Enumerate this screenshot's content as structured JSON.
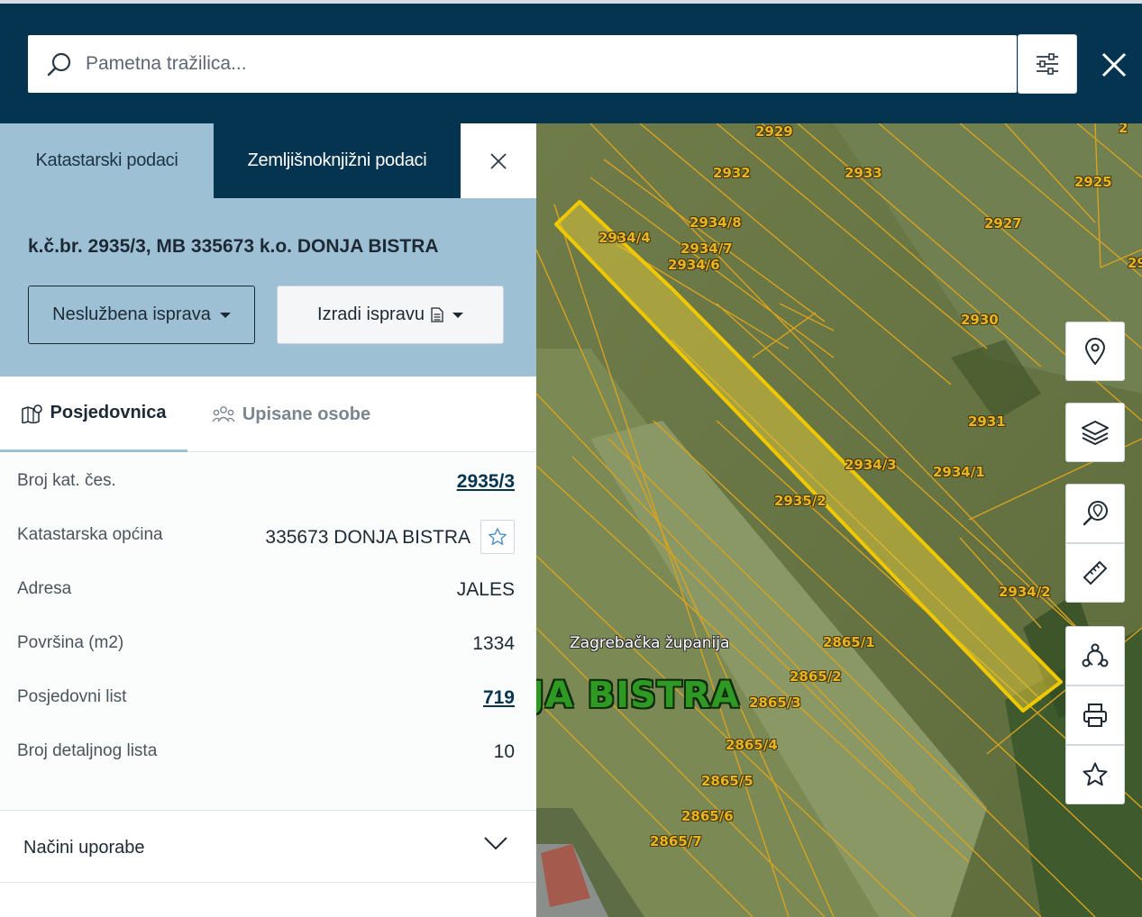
{
  "search": {
    "placeholder": "Pametna tražilica..."
  },
  "icons": {
    "search": "search-icon",
    "filter": "sliders-icon",
    "close": "close-icon",
    "document": "document-icon",
    "map_pin": "map-pin-icon",
    "layers": "layers-icon",
    "location_search": "location-search-icon",
    "ruler": "ruler-icon",
    "shapes": "shapes-icon",
    "print": "printer-icon",
    "star": "star-icon",
    "chevron": "chevron-down-icon"
  },
  "colors": {
    "header": "#04344f",
    "accent": "#9ec0d5",
    "parcel_outline": "#f0c800",
    "parcel_fill": "#d8c23a"
  },
  "tabs": [
    {
      "label": "Katastarski podaci",
      "active": true
    },
    {
      "label": "Zemljišnoknjižni podaci",
      "active": false
    }
  ],
  "parcel": {
    "title": "k.č.br. 2935/3, MB 335673 k.o. DONJA BISTRA",
    "btn_nesluzbena": "Neslužbena isprava",
    "btn_izradi": "Izradi ispravu"
  },
  "subtabs": [
    {
      "label": "Posjedovnica",
      "active": true
    },
    {
      "label": "Upisane osobe",
      "active": false
    }
  ],
  "details": [
    {
      "label": "Broj kat. čes.",
      "value": "2935/3",
      "link": true
    },
    {
      "label": "Katastarska općina",
      "value": "335673 DONJA BISTRA",
      "link": false
    },
    {
      "label": "Adresa",
      "value": "JALES",
      "link": false
    },
    {
      "label": "Površina (m2)",
      "value": "1334",
      "link": false
    },
    {
      "label": "Posjedovni list",
      "value": "719",
      "link": true
    },
    {
      "label": "Broj detaljnog lista",
      "value": "10",
      "link": false
    }
  ],
  "nacini": {
    "label": "Načini uporabe"
  },
  "map": {
    "county": "Zagrebačka županija",
    "town": "JA BISTRA",
    "parcel_labels": [
      "2929",
      "2932",
      "2933",
      "2925",
      "2934/8",
      "2934/4",
      "2934/7",
      "2934/6",
      "2927",
      "2930",
      "2931",
      "2934/3",
      "2934/1",
      "2935/2",
      "2934/2",
      "2865/1",
      "2865/2",
      "2865/3",
      "2865/4",
      "2865/5",
      "2865/6",
      "2865/7",
      "29",
      "2"
    ]
  }
}
